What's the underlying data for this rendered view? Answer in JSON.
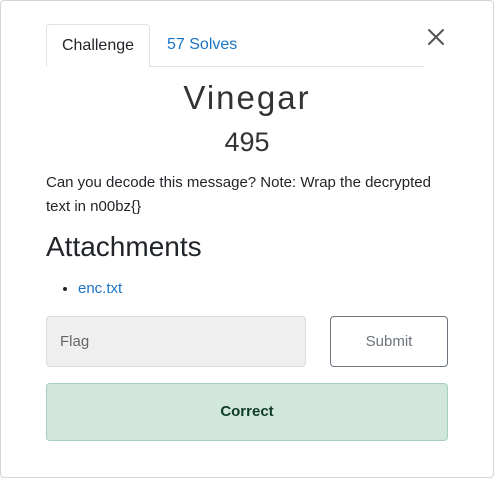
{
  "tabs": {
    "challenge_label": "Challenge",
    "solves_label": "57 Solves"
  },
  "challenge": {
    "name": "Vinegar",
    "points": "495",
    "description": "Can you decode this message? Note: Wrap the decrypted text in n00bz{}"
  },
  "attachments": {
    "heading": "Attachments",
    "files": [
      {
        "name": "enc.txt"
      }
    ]
  },
  "submission": {
    "flag_placeholder": "Flag",
    "submit_label": "Submit",
    "result_message": "Correct"
  },
  "colors": {
    "link": "#1b74c4",
    "success_bg": "#d1e7dd",
    "success_border": "#a6d0bb",
    "input_bg": "#efefef"
  },
  "icons": {
    "close": "close-icon"
  }
}
